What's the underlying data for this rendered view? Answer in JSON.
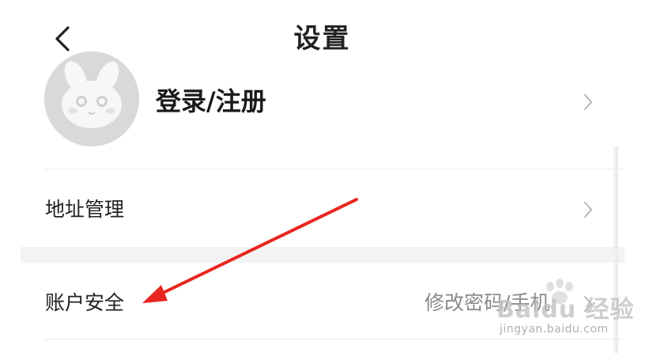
{
  "header": {
    "title": "设置",
    "back_icon": "chevron-left-icon"
  },
  "profile": {
    "login_label": "登录/注册",
    "avatar_icon": "rabbit-avatar-icon"
  },
  "rows": {
    "address": {
      "label": "地址管理"
    },
    "account_security": {
      "label": "账户安全",
      "value": "修改密码/手机"
    }
  },
  "watermark": {
    "logo_text": "Baidu 经验",
    "url": "jingyan.baidu.com"
  },
  "colors": {
    "annotation_arrow": "#e8261f",
    "divider": "#ebebeb",
    "chevron": "#b5b5b5",
    "avatar_bg": "#d9d9d9"
  }
}
